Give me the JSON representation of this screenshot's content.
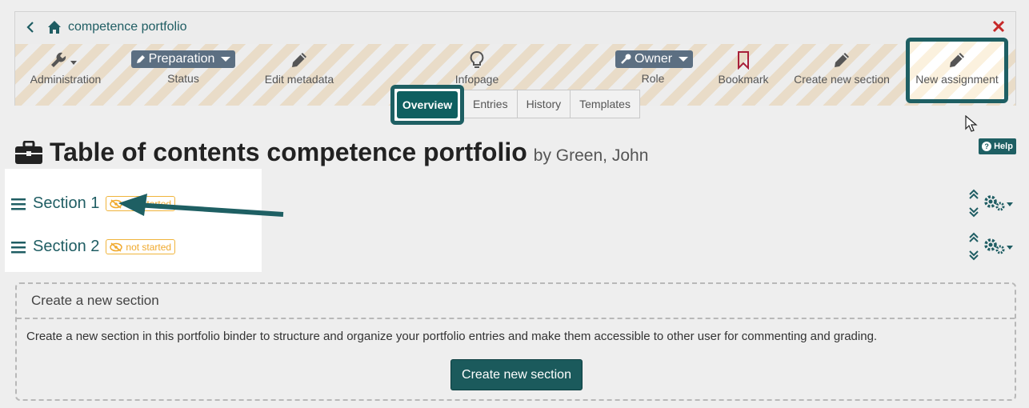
{
  "breadcrumb": {
    "label": "competence portfolio"
  },
  "toolbar": {
    "administration": "Administration",
    "status_value": "Preparation",
    "status_label": "Status",
    "edit_metadata": "Edit metadata",
    "infopage": "Infopage",
    "role_value": "Owner",
    "role_label": "Role",
    "bookmark": "Bookmark",
    "create_new_section": "Create new section",
    "new_assignment": "New assignment"
  },
  "tabs": [
    "Overview",
    "Entries",
    "History",
    "Templates"
  ],
  "help": "Help",
  "page": {
    "title": "Table of contents competence portfolio",
    "author": "by Green, John"
  },
  "sections": [
    {
      "label": "Section 1",
      "badge": "not started"
    },
    {
      "label": "Section 2",
      "badge": "not started"
    }
  ],
  "create_panel": {
    "heading": "Create a new section",
    "description": "Create a new section in this portfolio binder to structure and organize your portfolio entries and make them accessible to other user for commenting and grading.",
    "button": "Create new section"
  },
  "colors": {
    "accent": "#1e5f63",
    "badge": "#f0a92c",
    "close": "#c62828"
  },
  "icons": [
    "back-icon",
    "home-icon",
    "close-icon",
    "wrench-icon",
    "pencil-icon",
    "lightbulb-icon",
    "key-icon",
    "bookmark-icon",
    "briefcase-icon",
    "menu-icon",
    "eye-slash-icon",
    "updown-icon",
    "gears-icon",
    "cursor-icon",
    "help-icon"
  ]
}
